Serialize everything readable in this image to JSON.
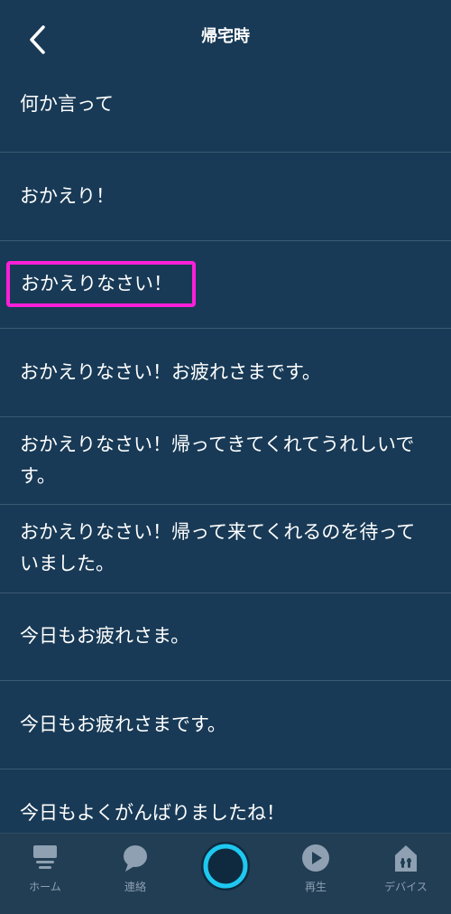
{
  "header": {
    "title": "帰宅時"
  },
  "list": {
    "items": [
      {
        "text": "何か言って"
      },
      {
        "text": "おかえり！"
      },
      {
        "text": "おかえりなさい！"
      },
      {
        "text": "おかえりなさい！お疲れさまです。"
      },
      {
        "text": "おかえりなさい！帰ってきてくれてうれしいです。"
      },
      {
        "text": "おかえりなさい！帰って来てくれるのを待っていました。"
      },
      {
        "text": "今日もお疲れさま。"
      },
      {
        "text": "今日もお疲れさまです。"
      },
      {
        "text": "今日もよくがんばりましたね！"
      }
    ],
    "selected_index": 2,
    "highlight_color": "#ff1fd8"
  },
  "tabbar": {
    "home_label": "ホーム",
    "contacts_label": "連絡",
    "play_label": "再生",
    "devices_label": "デバイス",
    "alexa_ring_color": "#1ec8f0"
  }
}
